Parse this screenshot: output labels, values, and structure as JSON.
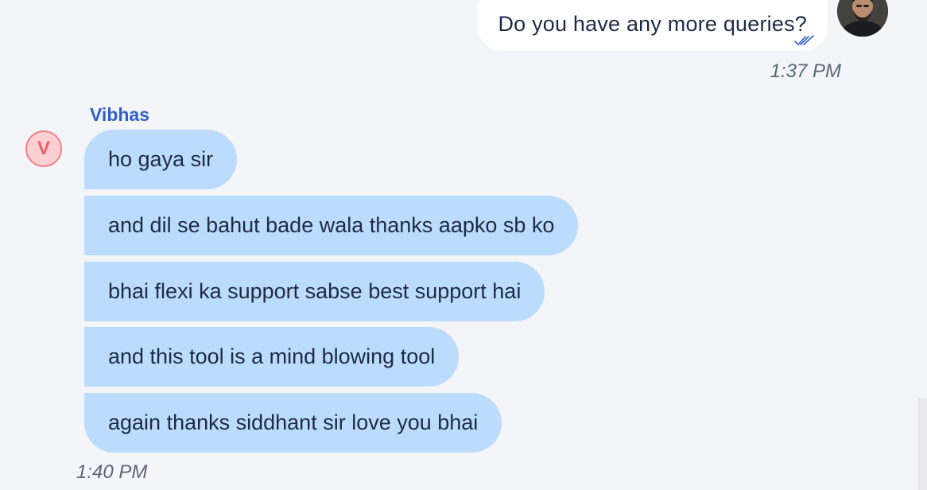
{
  "outgoing": {
    "text": "Do you have any more queries?",
    "time": "1:37 PM",
    "status_icon": "double-check-icon"
  },
  "incoming": {
    "sender": "Vibhas",
    "avatar_initial": "V",
    "messages": [
      "ho gaya sir",
      "and dil se bahut bade wala thanks aapko sb ko",
      "bhai flexi ka support sabse best support hai",
      "and this tool is a mind blowing tool",
      "again thanks siddhant sir love you bhai"
    ],
    "time": "1:40 PM"
  },
  "colors": {
    "background": "#f3f5f8",
    "incoming_bubble": "#bcdcfd",
    "outgoing_bubble": "#ffffff",
    "sender_name": "#2f5fc8",
    "avatar_bg": "#ffd0d3",
    "avatar_border": "#f08289"
  }
}
